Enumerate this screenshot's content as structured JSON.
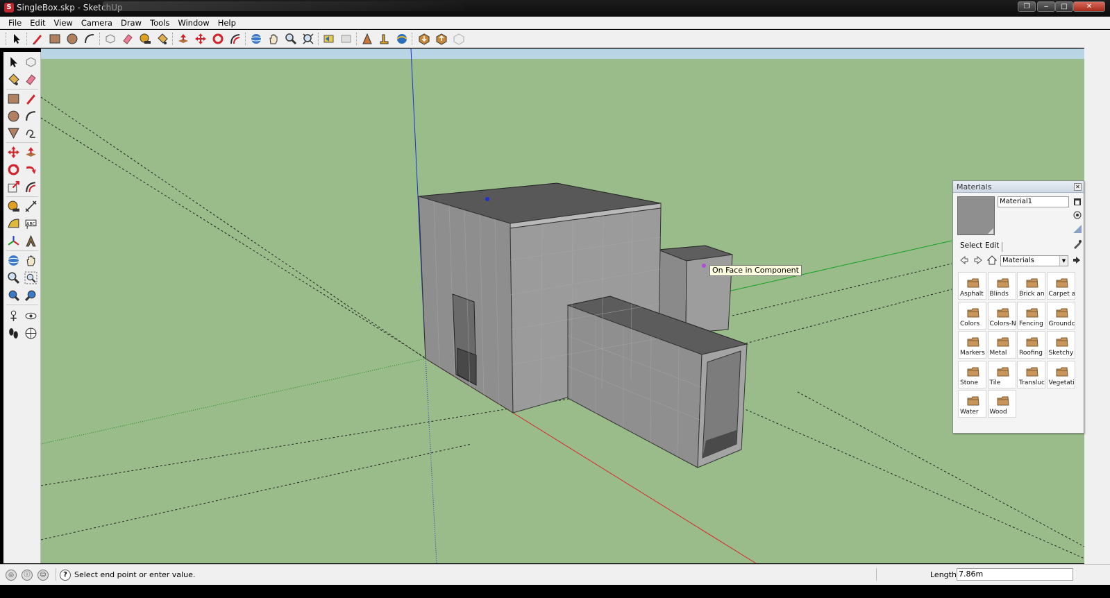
{
  "window": {
    "title": "SingleBox.skp - SketchUp",
    "app_icon": "sketchup-icon",
    "controls": [
      "minimize",
      "maximize",
      "close"
    ]
  },
  "menu": [
    "File",
    "Edit",
    "View",
    "Camera",
    "Draw",
    "Tools",
    "Window",
    "Help"
  ],
  "toolbar": {
    "tools": [
      "select",
      "pencil",
      "rectangle",
      "circle",
      "arc",
      "make-component",
      "eraser",
      "tape-measure",
      "paint-bucket",
      "push-pull",
      "move",
      "rotate",
      "offset",
      "orbit",
      "pan",
      "zoom",
      "zoom-extents",
      "previous",
      "next",
      "place-camera",
      "walk",
      "look-around",
      "get-models",
      "share-model",
      "3d-warehouse"
    ]
  },
  "left_toolbar": {
    "tools": [
      "select",
      "make-component",
      "paint-bucket",
      "eraser",
      "rectangle",
      "line",
      "circle",
      "arc",
      "polygon",
      "freehand",
      "move",
      "push-pull",
      "rotate",
      "follow-me",
      "scale",
      "offset",
      "tape-measure",
      "dimension",
      "protractor",
      "text",
      "axes",
      "3d-text",
      "orbit",
      "pan",
      "zoom",
      "zoom-window",
      "zoom-extents",
      "previous",
      "position-camera",
      "look-around",
      "walk",
      "section-plane"
    ]
  },
  "viewport": {
    "tooltip": "On Face in Component",
    "background_color": "#99bc8a",
    "sky_color": "#b9d4e4"
  },
  "materials_panel": {
    "title": "Materials",
    "material_name": "Material1",
    "preview_color": "#8f8f8f",
    "tabs": [
      "Select",
      "Edit"
    ],
    "library": "Materials",
    "items": [
      "Asphalt a",
      "Blinds",
      "Brick and",
      "Carpet a",
      "Colors",
      "Colors-N",
      "Fencing",
      "Groundc",
      "Markers",
      "Metal",
      "Roofing",
      "Sketchy",
      "Stone",
      "Tile",
      "Transluc",
      "Vegetatic",
      "Water",
      "Wood"
    ]
  },
  "status": {
    "message": "Select end point or enter value.",
    "length_label": "Length",
    "length_value": "7.86m"
  }
}
